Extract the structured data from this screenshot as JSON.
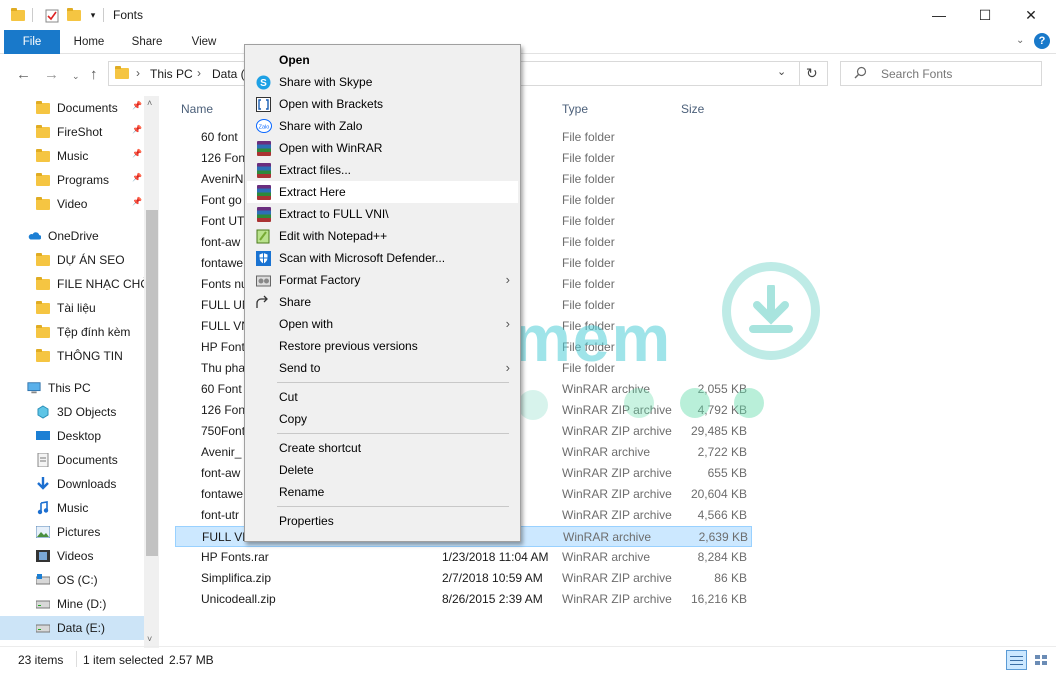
{
  "window": {
    "title": "Fonts",
    "controls": {
      "minimize": "—",
      "maximize": "☐",
      "close": "✕"
    }
  },
  "ribbon": {
    "tabs": [
      "File",
      "Home",
      "Share",
      "View"
    ],
    "help": "?"
  },
  "address": {
    "crumbs": [
      "This PC",
      "Data ("
    ],
    "search_placeholder": "Search Fonts"
  },
  "sidebar": {
    "quick_access": [
      {
        "label": "Documents",
        "pinned": true
      },
      {
        "label": "FireShot",
        "pinned": true
      },
      {
        "label": "Music",
        "pinned": true
      },
      {
        "label": "Programs",
        "pinned": true
      },
      {
        "label": "Video",
        "pinned": true
      }
    ],
    "onedrive": "OneDrive",
    "onedrive_items": [
      "DỰ ÁN SEO",
      "FILE NHẠC CHỜ",
      "Tài liệu",
      "Tệp đính kèm",
      "THÔNG TIN"
    ],
    "this_pc": "This PC",
    "pc_items": [
      "3D Objects",
      "Desktop",
      "Documents",
      "Downloads",
      "Music",
      "Pictures",
      "Videos",
      "OS (C:)",
      "Mine (D:)",
      "Data (E:)"
    ]
  },
  "columns": {
    "name": "Name",
    "date": "Date modified",
    "type": "Type",
    "size": "Size"
  },
  "files": [
    {
      "name": "60 font",
      "date": "7 PM",
      "type": "File folder",
      "size": "",
      "kind": "folder"
    },
    {
      "name": "126 Fon",
      "date": "7 PM",
      "type": "File folder",
      "size": "",
      "kind": "folder"
    },
    {
      "name": "AvenirN",
      "date": "M",
      "type": "File folder",
      "size": "",
      "kind": "folder"
    },
    {
      "name": "Font go",
      "date": "7 PM",
      "type": "File folder",
      "size": "",
      "kind": "folder"
    },
    {
      "name": "Font UT",
      "date": "1 PM",
      "type": "File folder",
      "size": "",
      "kind": "folder"
    },
    {
      "name": "font-aw",
      "date": "AM",
      "type": "File folder",
      "size": "",
      "kind": "folder"
    },
    {
      "name": "fontawe",
      "date": "AM",
      "type": "File folder",
      "size": "",
      "kind": "folder"
    },
    {
      "name": "Fonts nu",
      "date": "AM",
      "type": "File folder",
      "size": "",
      "kind": "folder"
    },
    {
      "name": "FULL UN",
      "date": "PM",
      "type": "File folder",
      "size": "",
      "kind": "folder"
    },
    {
      "name": "FULL VN",
      "date": "PM",
      "type": "File folder",
      "size": "",
      "kind": "folder"
    },
    {
      "name": "HP Font",
      "date": "PM",
      "type": "File folder",
      "size": "",
      "kind": "folder"
    },
    {
      "name": "Thu pha",
      "date": "PM",
      "type": "File folder",
      "size": "",
      "kind": "folder"
    },
    {
      "name": "60 Font",
      "date": "PM",
      "type": "WinRAR archive",
      "size": "2,055 KB",
      "kind": "rar"
    },
    {
      "name": "126 Fon",
      "date": "PM",
      "type": "WinRAR ZIP archive",
      "size": "4,792 KB",
      "kind": "rar"
    },
    {
      "name": "750Font",
      "date": "AM",
      "type": "WinRAR ZIP archive",
      "size": "29,485 KB",
      "kind": "rar"
    },
    {
      "name": "Avenir_",
      "date": "PM",
      "type": "WinRAR archive",
      "size": "2,722 KB",
      "kind": "rar"
    },
    {
      "name": "font-aw",
      "date": "AM",
      "type": "WinRAR ZIP archive",
      "size": "655 KB",
      "kind": "rar"
    },
    {
      "name": "fontawe",
      "date": "AM",
      "type": "WinRAR ZIP archive",
      "size": "20,604 KB",
      "kind": "rar"
    },
    {
      "name": "font-utr",
      "date": "AM",
      "type": "WinRAR ZIP archive",
      "size": "4,566 KB",
      "kind": "rar"
    },
    {
      "name": "FULL VN",
      "date": "PM",
      "type": "WinRAR archive",
      "size": "2,639 KB",
      "kind": "rar",
      "selected": true
    },
    {
      "name": "HP Fonts.rar",
      "date": "1/23/2018 11:04 AM",
      "type": "WinRAR archive",
      "size": "8,284 KB",
      "kind": "rar"
    },
    {
      "name": "Simplifica.zip",
      "date": "2/7/2018 10:59 AM",
      "type": "WinRAR ZIP archive",
      "size": "86 KB",
      "kind": "rar"
    },
    {
      "name": "Unicodeall.zip",
      "date": "8/26/2015 2:39 AM",
      "type": "WinRAR ZIP archive",
      "size": "16,216 KB",
      "kind": "rar"
    }
  ],
  "context_menu": [
    {
      "label": "Open",
      "icon": "none",
      "bold": true
    },
    {
      "label": "Share with Skype",
      "icon": "skype-icon"
    },
    {
      "label": "Open with Brackets",
      "icon": "brackets-icon"
    },
    {
      "label": "Share with Zalo",
      "icon": "zalo-icon"
    },
    {
      "label": "Open with WinRAR",
      "icon": "winrar-icon"
    },
    {
      "label": "Extract files...",
      "icon": "winrar-icon"
    },
    {
      "label": "Extract Here",
      "icon": "winrar-icon",
      "hover": true
    },
    {
      "label": "Extract to FULL VNI\\",
      "icon": "winrar-icon"
    },
    {
      "label": "Edit with Notepad++",
      "icon": "notepadpp-icon"
    },
    {
      "label": "Scan with Microsoft Defender...",
      "icon": "defender-icon"
    },
    {
      "label": "Format Factory",
      "icon": "formatfactory-icon",
      "submenu": true
    },
    {
      "label": "Share",
      "icon": "share-icon"
    },
    {
      "label": "Open with",
      "icon": "none",
      "submenu": true
    },
    {
      "label": "Restore previous versions",
      "icon": "none"
    },
    {
      "label": "Send to",
      "icon": "none",
      "submenu": true
    },
    {
      "label": "Cut",
      "icon": "none"
    },
    {
      "label": "Copy",
      "icon": "none"
    },
    {
      "label": "Create shortcut",
      "icon": "none"
    },
    {
      "label": "Delete",
      "icon": "none"
    },
    {
      "label": "Rename",
      "icon": "none"
    },
    {
      "label": "Properties",
      "icon": "none"
    }
  ],
  "status": {
    "items": "23 items",
    "selected": "1 item selected",
    "size": "2.57 MB"
  },
  "watermark": "Taiphanmem",
  "colors": {
    "accent": "#1979ca",
    "selection": "#cce8ff",
    "folder": "#f5c542"
  }
}
